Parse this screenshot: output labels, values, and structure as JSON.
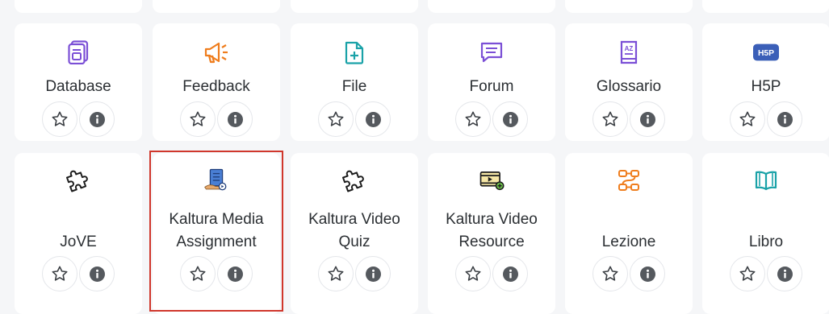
{
  "activities_row1": [
    {
      "key": "database",
      "label_lines": [
        "Database"
      ],
      "icon": "database-icon",
      "icon_color": "#7b4fd6"
    },
    {
      "key": "feedback",
      "label_lines": [
        "Feedback"
      ],
      "icon": "megaphone-icon",
      "icon_color": "#ef7d1d"
    },
    {
      "key": "file",
      "label_lines": [
        "File"
      ],
      "icon": "file-plus-icon",
      "icon_color": "#1aa2a8"
    },
    {
      "key": "forum",
      "label_lines": [
        "Forum"
      ],
      "icon": "chat-bubble-icon",
      "icon_color": "#7b4fd6"
    },
    {
      "key": "glossario",
      "label_lines": [
        "Glossario"
      ],
      "icon": "glossary-book-icon",
      "icon_color": "#7b4fd6"
    },
    {
      "key": "h5p",
      "label_lines": [
        "H5P"
      ],
      "icon": "h5p-logo",
      "icon_color": "#3b5fb8",
      "logo_text": "H5P"
    }
  ],
  "activities_row2": [
    {
      "key": "jove",
      "label_lines": [
        "JoVE"
      ],
      "icon": "puzzle-piece-icon",
      "icon_color": "#1c1c1c"
    },
    {
      "key": "kaltura-media-assignment",
      "label_lines": [
        "Kaltura Media",
        "Assignment"
      ],
      "icon": "kaltura-assignment-icon",
      "icon_color": "#3b6fc8"
    },
    {
      "key": "kaltura-video-quiz",
      "label_lines": [
        "Kaltura Video",
        "Quiz"
      ],
      "icon": "puzzle-piece-icon",
      "icon_color": "#1c1c1c"
    },
    {
      "key": "kaltura-video-resource",
      "label_lines": [
        "Kaltura Video",
        "Resource"
      ],
      "icon": "video-player-plus-icon",
      "icon_color": "#1c1c1c"
    },
    {
      "key": "lezione",
      "label_lines": [
        "Lezione"
      ],
      "icon": "lesson-flow-icon",
      "icon_color": "#ef7d1d"
    },
    {
      "key": "libro",
      "label_lines": [
        "Libro"
      ],
      "icon": "open-book-icon",
      "icon_color": "#1aa2a8"
    }
  ],
  "actions": {
    "star_icon": "star-outline-icon",
    "info_icon": "info-icon"
  },
  "colors": {
    "highlight_border": "#d0372c",
    "card_bg": "#ffffff",
    "page_bg": "#f5f6f8"
  }
}
